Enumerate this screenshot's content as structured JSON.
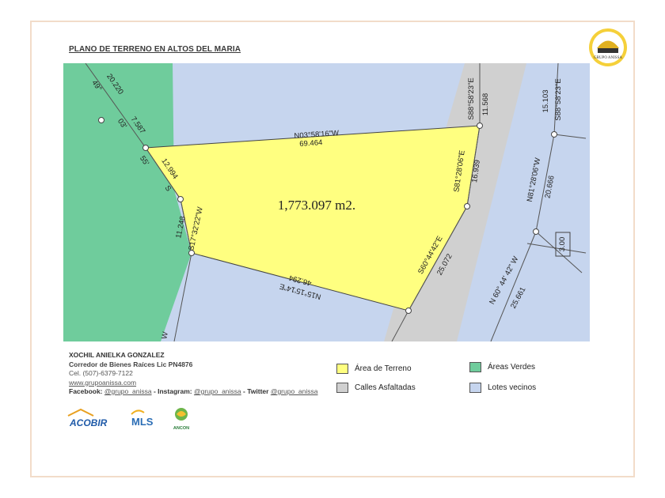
{
  "title": "PLANO DE TERRENO EN ALTOS DEL MARIA",
  "logo_text": "GRUPO ANISSA",
  "map": {
    "area_label": "1,773.097  m2.",
    "measurements": {
      "n03": "N03°58'16\"W",
      "n03_len": "69.464",
      "s88_a": "S88°58'23\"E",
      "s88_a_len": "11.568",
      "s81": "S81°28'06\"E",
      "s81_len": "16.939",
      "s60": "S60°44'42\"E",
      "s60_len": "25.072",
      "n15": "N15°15'14\"E",
      "n15_len": "46.294",
      "s17": "S17°32'22\"W",
      "s17_len": "11.248",
      "len_12994": "12.994",
      "s88_b": "S88°58'23\"E",
      "s88_b_len": "15.103",
      "n81": "N81°28'06\"W",
      "n81_len": "20.666",
      "road_bearing": "N  60°  44'  42\"  W",
      "road_len": "25.661",
      "box_val": "3.00",
      "left_49": "49°",
      "left_20220": "20.220",
      "left_03": "03'",
      "left_7587": "7.587",
      "left_55": "55'",
      "left_s": "S",
      "left_w": "W"
    }
  },
  "agent": {
    "name": "XOCHIL ANIELKA GONZALEZ",
    "license": "Corredor de Bienes Raíces Lic PN4876",
    "phone": "Cel. (507)-6379-7122",
    "website": "www.grupoanissa.com",
    "social_prefix_fb": "Facebook:",
    "handle_fb": "@grupo_anissa",
    "social_prefix_ig": "- Instagram:",
    "handle_ig": "@grupo_anissa",
    "social_prefix_tw": "- Twitter",
    "handle_tw": "@grupo_anissa"
  },
  "legend": [
    {
      "label": "Área de Terreno",
      "color": "#ffff80"
    },
    {
      "label": "Calles Asfaltadas",
      "color": "#d0d0d0"
    },
    {
      "label": "Áreas Verdes",
      "color": "#6fcc9c"
    },
    {
      "label": "Lotes vecinos",
      "color": "#c6d5ee"
    }
  ],
  "partner_logos": {
    "acobir": "ACOBIR",
    "mls": "MLS",
    "ancon": "ANCON"
  },
  "colors": {
    "terrain": "#ffff80",
    "streets": "#d0d0d0",
    "green": "#6fcc9c",
    "neighbors": "#c6d5ee"
  }
}
